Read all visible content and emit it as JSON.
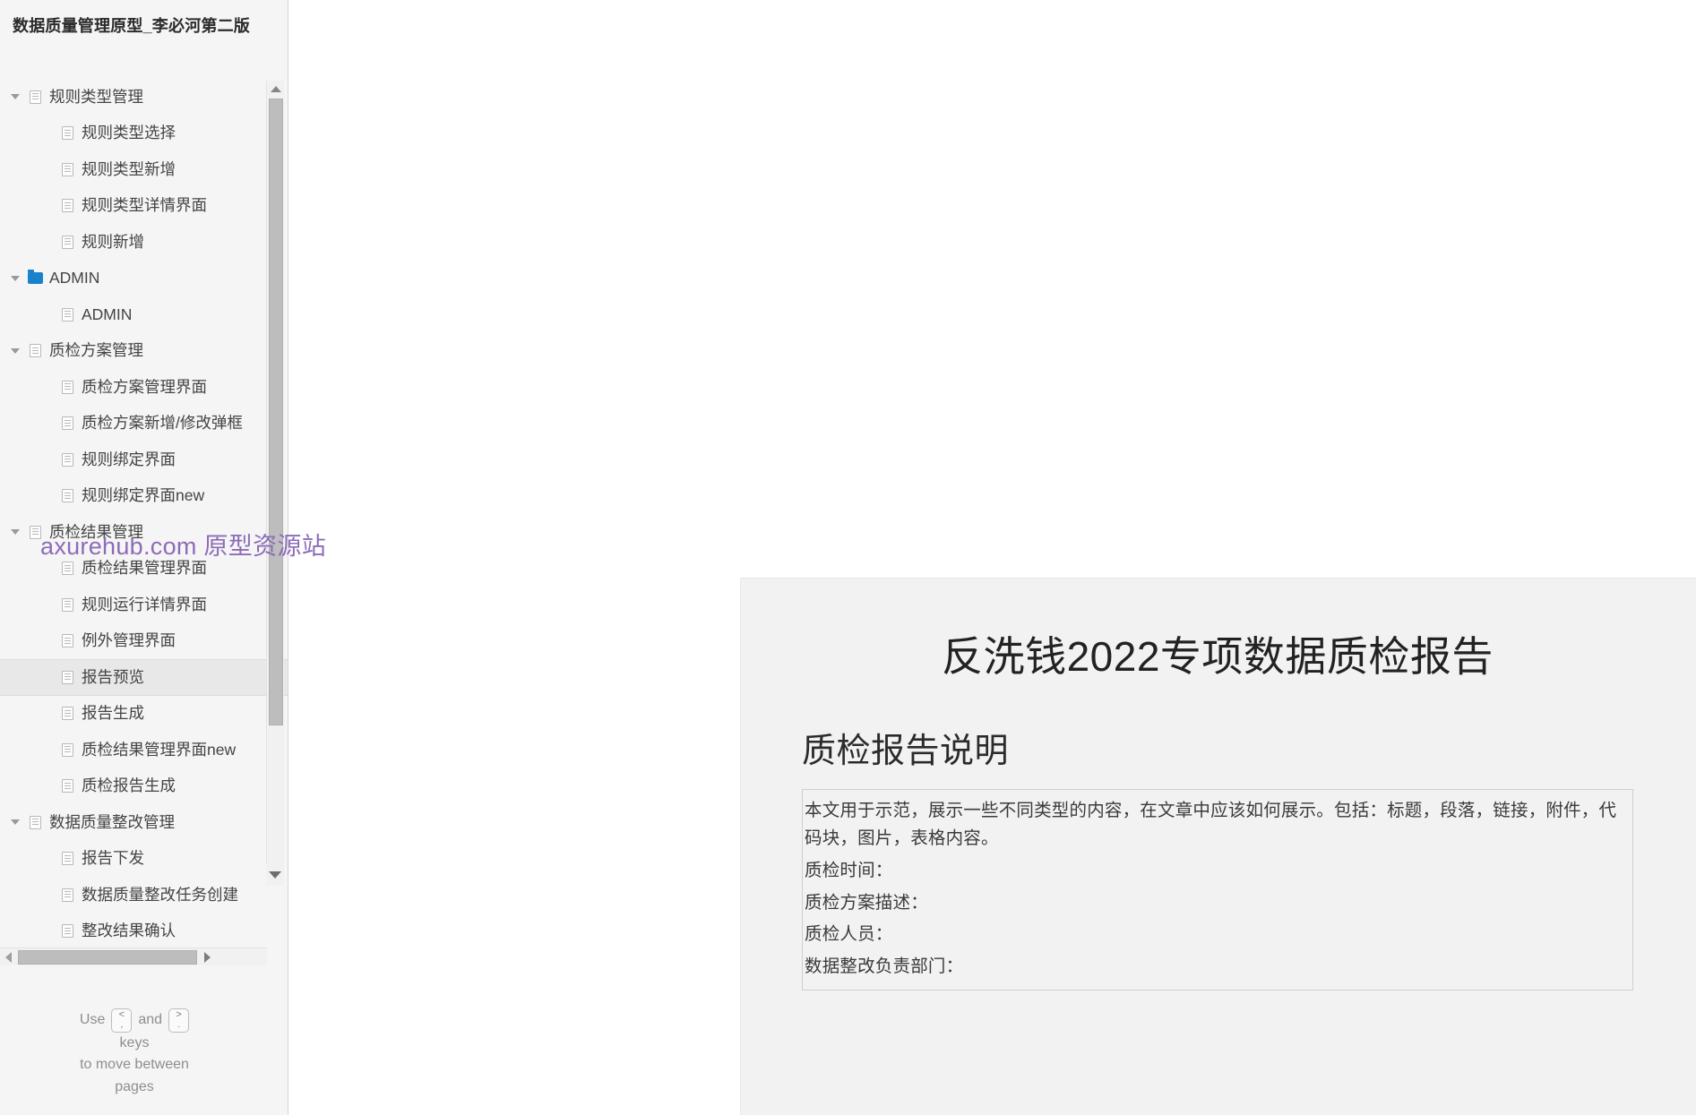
{
  "sidebar": {
    "title": "数据质量管理原型_李必河第二版",
    "tree": [
      {
        "label": "规则类型管理",
        "depth": 1,
        "icon": "page-icon",
        "arrow": "open",
        "selected": false
      },
      {
        "label": "规则类型选择",
        "depth": 2,
        "icon": "page-icon",
        "arrow": "none",
        "selected": false
      },
      {
        "label": "规则类型新增",
        "depth": 2,
        "icon": "page-icon",
        "arrow": "none",
        "selected": false
      },
      {
        "label": "规则类型详情界面",
        "depth": 2,
        "icon": "page-icon",
        "arrow": "none",
        "selected": false
      },
      {
        "label": "规则新增",
        "depth": 2,
        "icon": "page-icon",
        "arrow": "none",
        "selected": false
      },
      {
        "label": "ADMIN",
        "depth": 1,
        "icon": "folder-icon",
        "arrow": "open",
        "selected": false
      },
      {
        "label": "ADMIN",
        "depth": 2,
        "icon": "page-icon",
        "arrow": "none",
        "selected": false
      },
      {
        "label": "质检方案管理",
        "depth": 1,
        "icon": "page-icon",
        "arrow": "open",
        "selected": false
      },
      {
        "label": "质检方案管理界面",
        "depth": 2,
        "icon": "page-icon",
        "arrow": "none",
        "selected": false
      },
      {
        "label": "质检方案新增/修改弹框",
        "depth": 2,
        "icon": "page-icon",
        "arrow": "none",
        "selected": false
      },
      {
        "label": "规则绑定界面",
        "depth": 2,
        "icon": "page-icon",
        "arrow": "none",
        "selected": false
      },
      {
        "label": "规则绑定界面new",
        "depth": 2,
        "icon": "page-icon",
        "arrow": "none",
        "selected": false
      },
      {
        "label": "质检结果管理",
        "depth": 1,
        "icon": "page-icon",
        "arrow": "open",
        "selected": false
      },
      {
        "label": "质检结果管理界面",
        "depth": 2,
        "icon": "page-icon",
        "arrow": "none",
        "selected": false
      },
      {
        "label": "规则运行详情界面",
        "depth": 2,
        "icon": "page-icon",
        "arrow": "none",
        "selected": false
      },
      {
        "label": "例外管理界面",
        "depth": 2,
        "icon": "page-icon",
        "arrow": "none",
        "selected": false
      },
      {
        "label": "报告预览",
        "depth": 2,
        "icon": "page-icon",
        "arrow": "none",
        "selected": true
      },
      {
        "label": "报告生成",
        "depth": 2,
        "icon": "page-icon",
        "arrow": "none",
        "selected": false
      },
      {
        "label": "质检结果管理界面new",
        "depth": 2,
        "icon": "page-icon",
        "arrow": "none",
        "selected": false
      },
      {
        "label": "质检报告生成",
        "depth": 2,
        "icon": "page-icon",
        "arrow": "none",
        "selected": false
      },
      {
        "label": "数据质量整改管理",
        "depth": 1,
        "icon": "page-icon",
        "arrow": "open",
        "selected": false
      },
      {
        "label": "报告下发",
        "depth": 2,
        "icon": "page-icon",
        "arrow": "none",
        "selected": false
      },
      {
        "label": "数据质量整改任务创建",
        "depth": 2,
        "icon": "page-icon",
        "arrow": "none",
        "selected": false
      },
      {
        "label": "整改结果确认",
        "depth": 2,
        "icon": "page-icon",
        "arrow": "none",
        "selected": false
      }
    ],
    "keyboard_hint": {
      "use": "Use",
      "and": "and",
      "prev_key_top": "<",
      "prev_key_bottom": ",",
      "next_key_top": ">",
      "next_key_bottom": ".",
      "keys_word": "keys",
      "line3": "to move between",
      "line4": "pages"
    }
  },
  "watermark": {
    "text": "axurehub.com 原型资源站",
    "color": "#8d6cb8"
  },
  "report": {
    "title": "反洗钱2022专项数据质检报告",
    "section_heading": "质检报告说明",
    "intro": "本文用于示范，展示一些不同类型的内容，在文章中应该如何展示。包括：标题，段落，链接，附件，代码块，图片，表格内容。",
    "fields": [
      "质检时间：",
      "质检方案描述：",
      "质检人员：",
      "数据整改负责部门："
    ]
  },
  "colors": {
    "sidebar_bg": "#f5f5f5",
    "card_bg": "#f2f2f2",
    "selected_row": "#e8e8e8",
    "folder_blue": "#1a81cd"
  }
}
